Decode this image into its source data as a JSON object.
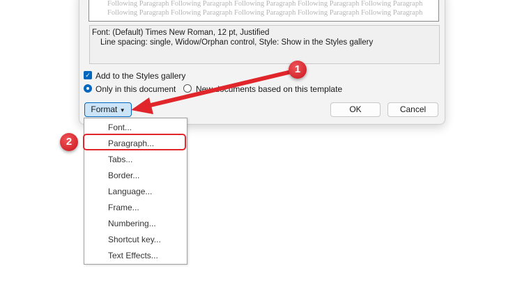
{
  "preview": {
    "lines": [
      "Following Paragraph Following Paragraph Following Paragraph Following Paragraph Following Paragraph",
      "Following Paragraph Following Paragraph Following Paragraph Following Paragraph Following Paragraph"
    ]
  },
  "description": {
    "line1": "Font: (Default) Times New Roman, 12 pt, Justified",
    "line2": "Line spacing:  single, Widow/Orphan control, Style: Show in the Styles gallery"
  },
  "options": {
    "add_to_gallery": "Add to the Styles gallery",
    "add_checked": true,
    "only_doc": "Only in this document",
    "new_docs": "New documents based on this template",
    "selected": "Only in this document"
  },
  "buttons": {
    "format": "Format",
    "ok": "OK",
    "cancel": "Cancel"
  },
  "menu": {
    "items": [
      "Font...",
      "Paragraph...",
      "Tabs...",
      "Border...",
      "Language...",
      "Frame...",
      "Numbering...",
      "Shortcut key...",
      "Text Effects..."
    ]
  },
  "annotations": {
    "step1": "1",
    "step2": "2",
    "color": "#e0262b"
  }
}
